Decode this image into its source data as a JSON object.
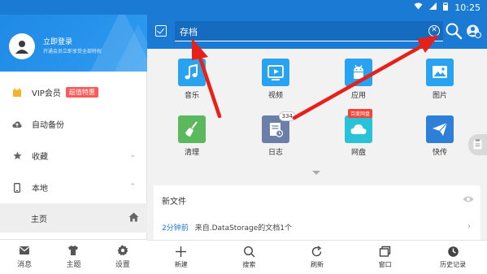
{
  "status": {
    "time": "10:25"
  },
  "profile": {
    "login": "立即登录",
    "subtitle": "开通会员立即享受全部特权"
  },
  "sidebar": {
    "items": [
      {
        "label": "VIP会员",
        "badge": "超值特惠",
        "icon": "vip-icon"
      },
      {
        "label": "自动备份",
        "icon": "cloud-backup-icon"
      },
      {
        "label": "收藏",
        "icon": "star-icon"
      },
      {
        "label": "本地",
        "icon": "phone-icon"
      }
    ],
    "sub": {
      "label": "主页",
      "icon": "home-icon"
    },
    "tabs": [
      {
        "label": "消息",
        "icon": "message-icon"
      },
      {
        "label": "主题",
        "icon": "shirt-icon"
      },
      {
        "label": "设置",
        "icon": "gear-icon"
      }
    ]
  },
  "search": {
    "value": "存档"
  },
  "apps": [
    {
      "label": "音乐",
      "icon": "music-icon",
      "color": "#29a3f0"
    },
    {
      "label": "视频",
      "icon": "video-icon",
      "color": "#29a3f0"
    },
    {
      "label": "应用",
      "icon": "android-icon",
      "color": "#29a3f0"
    },
    {
      "label": "图片",
      "icon": "image-icon",
      "color": "#29a3f0"
    },
    {
      "label": "清理",
      "icon": "broom-icon",
      "color": "#5cb85c"
    },
    {
      "label": "日志",
      "icon": "log-icon",
      "color": "#6b7fa8",
      "count": "334"
    },
    {
      "label": "网盘",
      "icon": "cloud-drive-icon",
      "color": "#29c2d6",
      "tag": "百度网盘"
    },
    {
      "label": "快传",
      "icon": "paper-plane-icon",
      "color": "#2e7fd8"
    }
  ],
  "recent": {
    "title": "新文件",
    "time": "2分钟前",
    "desc": "来自.DataStorage的文档1个"
  },
  "bottom": [
    {
      "label": "新建",
      "icon": "plus-icon"
    },
    {
      "label": "搜索",
      "icon": "search-icon"
    },
    {
      "label": "刷新",
      "icon": "refresh-icon"
    },
    {
      "label": "窗口",
      "icon": "window-icon"
    },
    {
      "label": "历史记录",
      "icon": "history-icon"
    }
  ],
  "colors": {
    "primary": "#1a7ad4",
    "annotation": "#e8201a"
  }
}
